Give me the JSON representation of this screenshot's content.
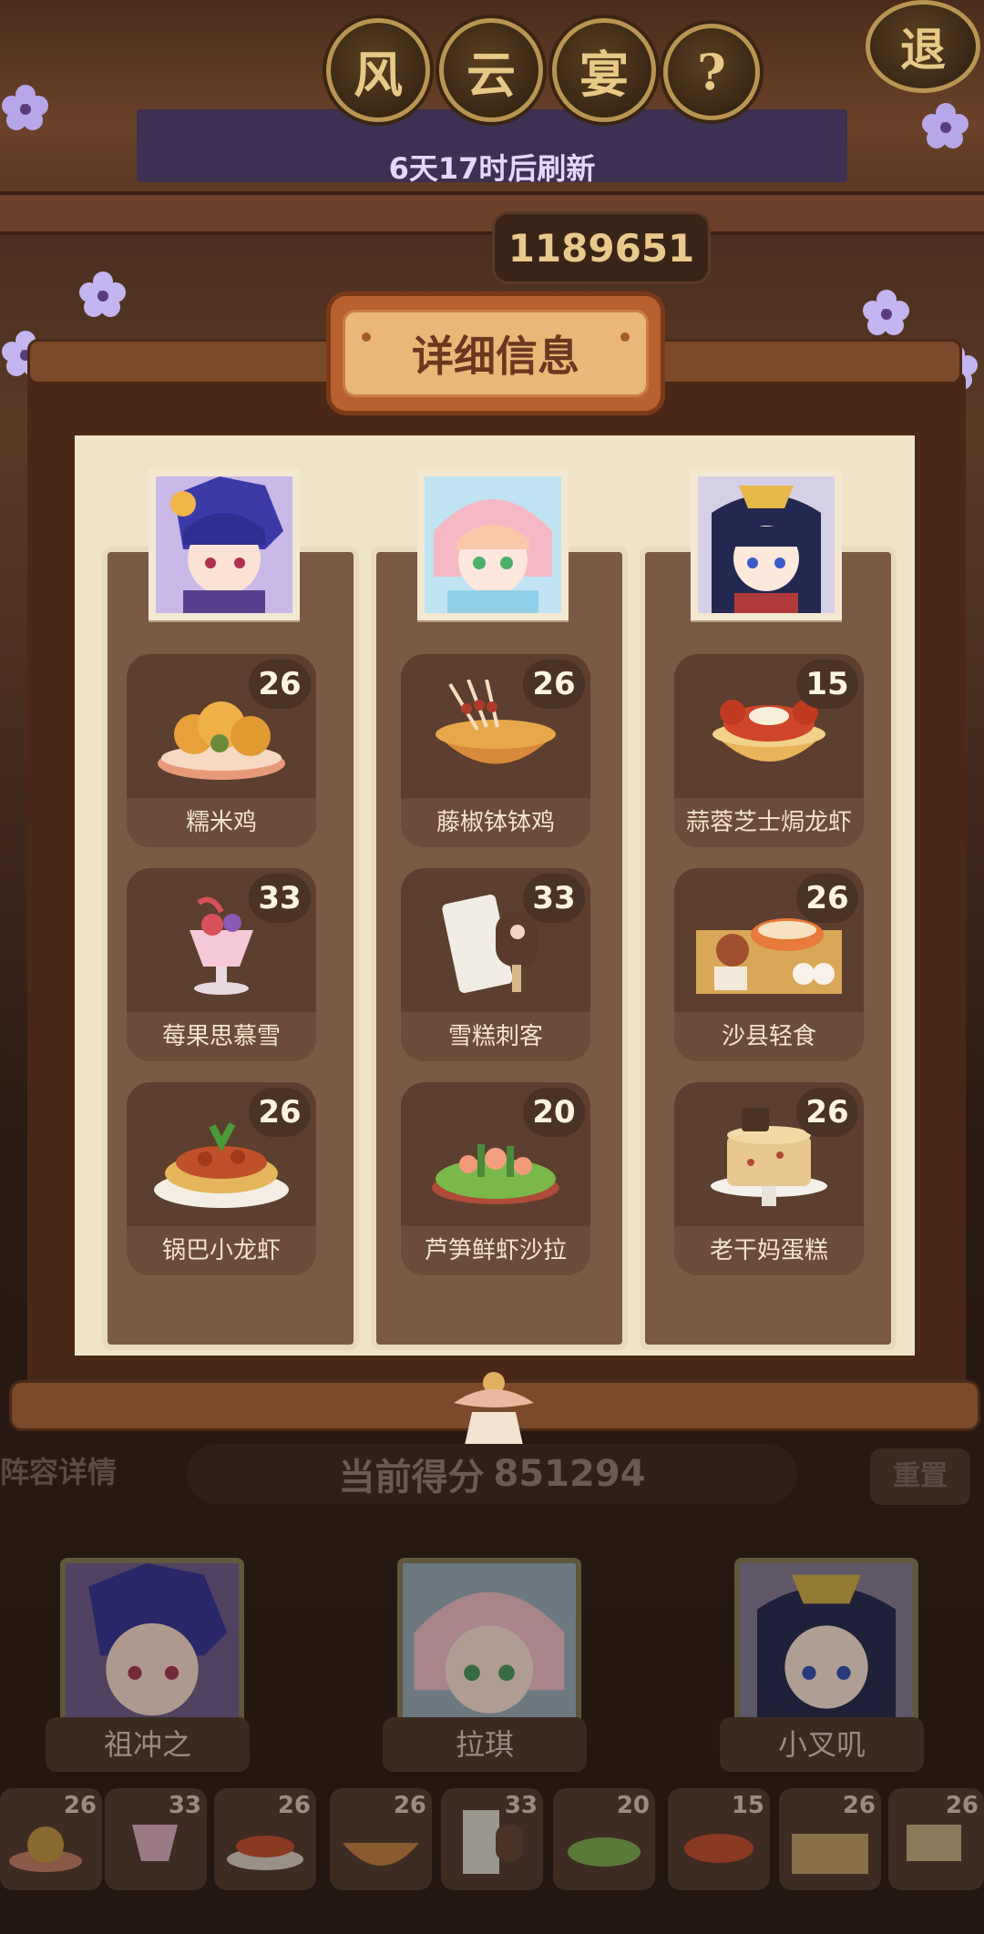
{
  "header": {
    "title_chars": [
      "风",
      "云",
      "宴"
    ],
    "help_label": "?",
    "exit_label": "退",
    "refresh_text": "6天17时后刷新",
    "total_score": "1189651"
  },
  "panel": {
    "title": "详细信息",
    "columns": [
      {
        "portrait_icon": "hero-portrait-zuchongzhi",
        "dishes": [
          {
            "name": "糯米鸡",
            "score": "26",
            "icon": "sticky-rice-chicken-icon"
          },
          {
            "name": "莓果思慕雪",
            "score": "33",
            "icon": "berry-smoothie-icon"
          },
          {
            "name": "锅巴小龙虾",
            "score": "26",
            "icon": "crispy-crayfish-icon"
          }
        ]
      },
      {
        "portrait_icon": "hero-portrait-laqi",
        "dishes": [
          {
            "name": "藤椒钵钵鸡",
            "score": "26",
            "icon": "pepper-chicken-skewers-icon"
          },
          {
            "name": "雪糕刺客",
            "score": "33",
            "icon": "ice-cream-assassin-icon"
          },
          {
            "name": "芦笋鲜虾沙拉",
            "score": "20",
            "icon": "asparagus-shrimp-salad-icon"
          }
        ]
      },
      {
        "portrait_icon": "hero-portrait-xiaochaji",
        "dishes": [
          {
            "name": "蒜蓉芝士焗龙虾",
            "score": "15",
            "icon": "garlic-cheese-lobster-icon"
          },
          {
            "name": "沙县轻食",
            "score": "26",
            "icon": "shaxian-snack-icon"
          },
          {
            "name": "老干妈蛋糕",
            "score": "26",
            "icon": "laoganma-cake-icon"
          }
        ]
      }
    ]
  },
  "bottom": {
    "lineup_tab": "阵容详情",
    "current_score_label": "当前得分",
    "current_score_value": "851294",
    "reset_label": "重置",
    "heroes": [
      {
        "name": "祖冲之"
      },
      {
        "name": "拉琪"
      },
      {
        "name": "小叉叽"
      }
    ],
    "dish_strip": [
      "26",
      "33",
      "26",
      "26",
      "33",
      "20",
      "15",
      "26",
      "26"
    ]
  },
  "colors": {
    "accent_gold": "#e7c987",
    "panel_paper": "#f1e3c8",
    "dish_card": "#5c3f2e",
    "header_orange": "#b8602f"
  }
}
